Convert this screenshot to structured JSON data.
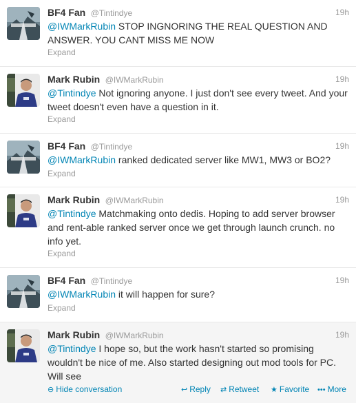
{
  "colors": {
    "link": "#0084b4",
    "meta": "#999999",
    "text": "#333333",
    "expanded_bg": "#f5f5f5"
  },
  "tweets": [
    {
      "fullname": "BF4 Fan",
      "username": "@Tintindye",
      "time": "19h",
      "mention": "@IWMarkRubin",
      "text": " STOP INGNORING THE REAL QUESTION AND ANSWER. YOU CANT MISS ME NOW",
      "expand": "Expand",
      "avatar": "bf4-avatar"
    },
    {
      "fullname": "Mark Rubin",
      "username": "@IWMarkRubin",
      "time": "19h",
      "mention": "@Tintindye",
      "text": " Not ignoring anyone. I just don't see every tweet. And your tweet doesn't even have a question in it.",
      "expand": "Expand",
      "avatar": "mark-avatar"
    },
    {
      "fullname": "BF4 Fan",
      "username": "@Tintindye",
      "time": "19h",
      "mention": "@IWMarkRubin",
      "text": " ranked dedicated server like MW1, MW3 or BO2?",
      "expand": "Expand",
      "avatar": "bf4-avatar"
    },
    {
      "fullname": "Mark Rubin",
      "username": "@IWMarkRubin",
      "time": "19h",
      "mention": "@Tintindye",
      "text": " Matchmaking onto dedis. Hoping to add server browser and rent-able ranked server once we get through launch crunch. no info yet.",
      "expand": "Expand",
      "avatar": "mark-avatar"
    },
    {
      "fullname": "BF4 Fan",
      "username": "@Tintindye",
      "time": "19h",
      "mention": "@IWMarkRubin",
      "text": " it will happen for sure?",
      "expand": "Expand",
      "avatar": "bf4-avatar"
    },
    {
      "fullname": "Mark Rubin",
      "username": "@IWMarkRubin",
      "time": "19h",
      "mention": "@Tintindye",
      "text": " I hope so, but the work hasn't started so promising wouldn't be nice of me. Also started designing out mod tools for PC. Will see",
      "avatar": "mark-avatar"
    }
  ],
  "actions": {
    "hide_conversation": "Hide conversation",
    "reply": "Reply",
    "retweet": "Retweet",
    "favorite": "Favorite",
    "more": "More",
    "hide_icon": "minus-circle-icon",
    "reply_icon": "reply-arrow-icon",
    "retweet_icon": "retweet-icon",
    "favorite_icon": "star-icon",
    "more_icon": "dots-icon"
  }
}
